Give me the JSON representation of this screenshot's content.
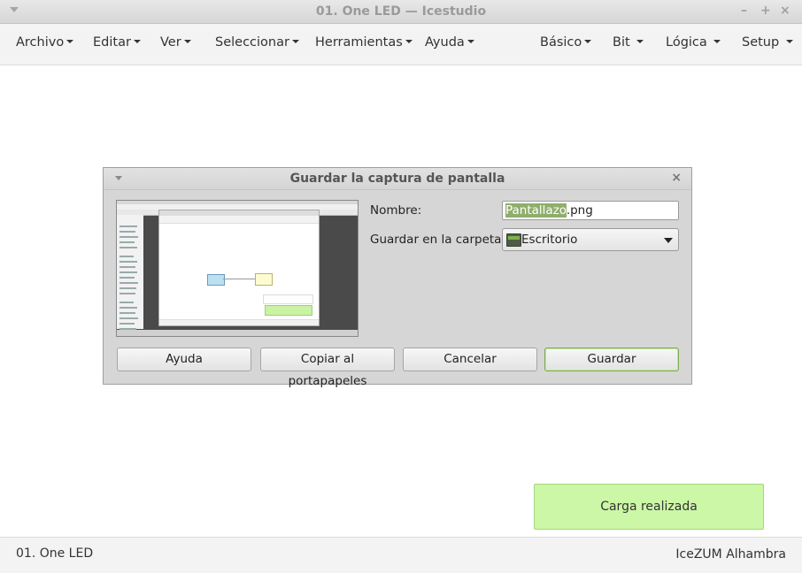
{
  "window": {
    "title": "01. One LED — Icestudio",
    "controls": [
      "–",
      "+",
      "×"
    ]
  },
  "menubar": {
    "left": [
      "Archivo",
      "Editar",
      "Ver",
      "Seleccionar",
      "Herramientas",
      "Ayuda"
    ],
    "right": [
      "Básico",
      "Bit",
      "Lógica",
      "Setup"
    ]
  },
  "dialog": {
    "title": "Guardar la captura de pantalla",
    "close": "×",
    "name_label": "Nombre:",
    "name_value_selected": "Pantallazo",
    "name_value_rest": ".png",
    "folder_label": "Guardar en la carpeta:",
    "folder_value": "Escritorio",
    "buttons": {
      "help": "Ayuda",
      "copy": "Copiar al portapapeles",
      "cancel": "Cancelar",
      "save": "Guardar"
    }
  },
  "notification": "Carga realizada",
  "status": {
    "project": "01. One LED",
    "board": "IceZUM Alhambra"
  },
  "colors": {
    "notification_bg": "#ccf7a6",
    "selection": "#8fae6b",
    "primary_border": "#7cab4c"
  }
}
